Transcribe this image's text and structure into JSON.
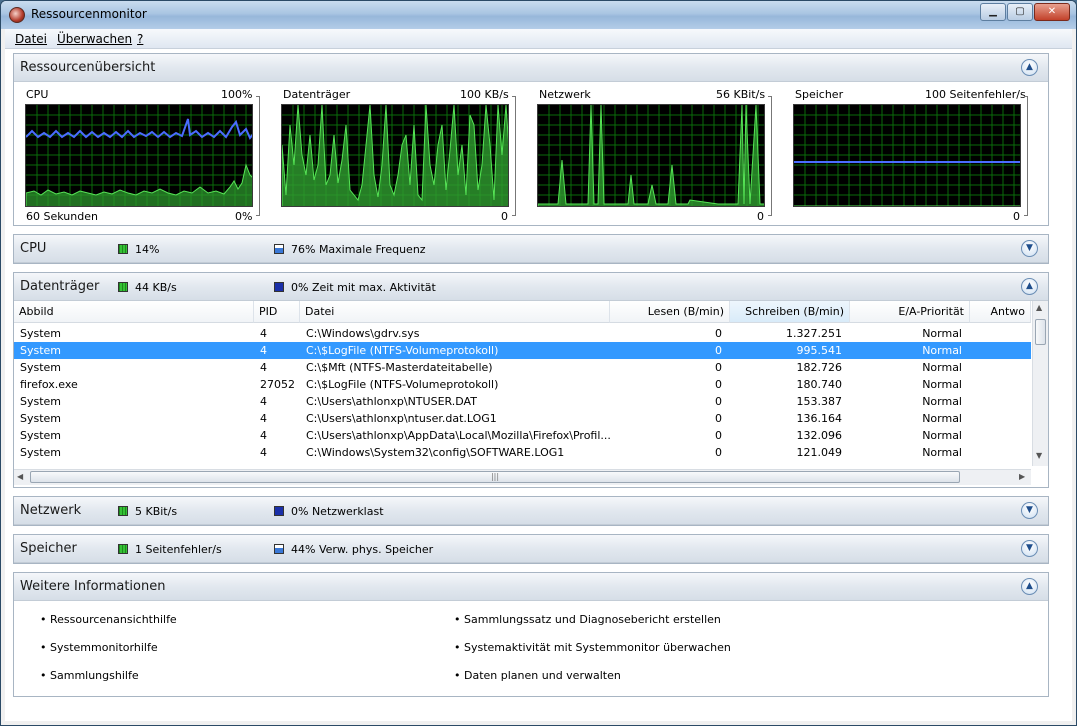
{
  "window": {
    "title": "Ressourcenmonitor"
  },
  "menu": [
    "Datei",
    "Überwachen",
    "?"
  ],
  "overview": {
    "title": "Ressourcenübersicht",
    "graphs": [
      {
        "name": "CPU",
        "scale": "100%",
        "bottom_left": "60 Sekunden",
        "bottom_right": "0%"
      },
      {
        "name": "Datenträger",
        "scale": "100 KB/s",
        "bottom_left": "",
        "bottom_right": "0"
      },
      {
        "name": "Netzwerk",
        "scale": "56 KBit/s",
        "bottom_left": "",
        "bottom_right": "0"
      },
      {
        "name": "Speicher",
        "scale": "100 Seitenfehler/s",
        "bottom_left": "",
        "bottom_right": "0"
      }
    ]
  },
  "cpu": {
    "title": "CPU",
    "stat1": "14%",
    "stat2": "76% Maximale Frequenz"
  },
  "disk": {
    "title": "Datenträger",
    "stat1": "44 KB/s",
    "stat2": "0% Zeit mit max. Aktivität",
    "columns": [
      "Abbild",
      "PID",
      "Datei",
      "Lesen (B/min)",
      "Schreiben (B/min)",
      "E/A-Priorität",
      "Antwo"
    ],
    "rows": [
      [
        "System",
        "4",
        "C:\\Windows\\gdrv.sys",
        "0",
        "1.327.251",
        "Normal"
      ],
      [
        "System",
        "4",
        "C:\\$LogFile (NTFS-Volumeprotokoll)",
        "0",
        "995.541",
        "Normal"
      ],
      [
        "System",
        "4",
        "C:\\$Mft (NTFS-Masterdateitabelle)",
        "0",
        "182.726",
        "Normal"
      ],
      [
        "firefox.exe",
        "27052",
        "C:\\$LogFile (NTFS-Volumeprotokoll)",
        "0",
        "180.740",
        "Normal"
      ],
      [
        "System",
        "4",
        "C:\\Users\\athlonxp\\NTUSER.DAT",
        "0",
        "153.387",
        "Normal"
      ],
      [
        "System",
        "4",
        "C:\\Users\\athlonxp\\ntuser.dat.LOG1",
        "0",
        "136.164",
        "Normal"
      ],
      [
        "System",
        "4",
        "C:\\Users\\athlonxp\\AppData\\Local\\Mozilla\\Firefox\\Profil...",
        "0",
        "132.096",
        "Normal"
      ],
      [
        "System",
        "4",
        "C:\\Windows\\System32\\config\\SOFTWARE.LOG1",
        "0",
        "121.049",
        "Normal"
      ]
    ],
    "selected_row": 1
  },
  "network": {
    "title": "Netzwerk",
    "stat1": "5 KBit/s",
    "stat2": "0% Netzwerklast"
  },
  "memory": {
    "title": "Speicher",
    "stat1": "1 Seitenfehler/s",
    "stat2": "44% Verw. phys. Speicher"
  },
  "info": {
    "title": "Weitere Informationen",
    "left": [
      "Ressourcenansichthilfe",
      "Systemmonitorhilfe",
      "Sammlungshilfe"
    ],
    "right": [
      "Sammlungssatz und Diagnosebericht erstellen",
      "Systemaktivität mit Systemmonitor überwachen",
      "Daten planen und verwalten"
    ]
  },
  "colors": {
    "graph_bg": "#000000",
    "grid": "#0a7a0a",
    "green": "#3ad03a",
    "blue": "#3b5bff",
    "selection": "#3399ff"
  },
  "icons": {
    "collapse": "chevron-up-icon",
    "expand": "chevron-down-icon"
  }
}
